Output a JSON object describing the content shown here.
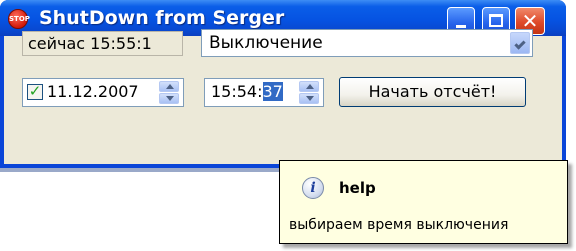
{
  "window": {
    "title": "ShutDown from Serger",
    "app_icon": {
      "name": "stop-icon",
      "text": "STOP"
    },
    "controls": {
      "minimize": "minimize-icon",
      "maximize": "maximize-icon",
      "close": "close-icon",
      "close_glyph": "✕"
    }
  },
  "main": {
    "clock_label": "сейчас 15:55:1",
    "action_select": {
      "selected": "Выключение"
    },
    "date_picker": {
      "checked": true,
      "check_glyph": "✓",
      "value": "11.12.2007"
    },
    "time_picker": {
      "hours_minutes": "15:54:",
      "seconds": "37"
    },
    "start_button": "Начать отсчёт!"
  },
  "tooltip": {
    "icon": "info-icon",
    "icon_glyph": "i",
    "title": "help",
    "text": "выбираем время выключения"
  },
  "colors": {
    "titlebar": "#0653e2",
    "client_bg": "#ece9d8",
    "tooltip_bg": "#ffffe1",
    "selection": "#316ac5"
  }
}
